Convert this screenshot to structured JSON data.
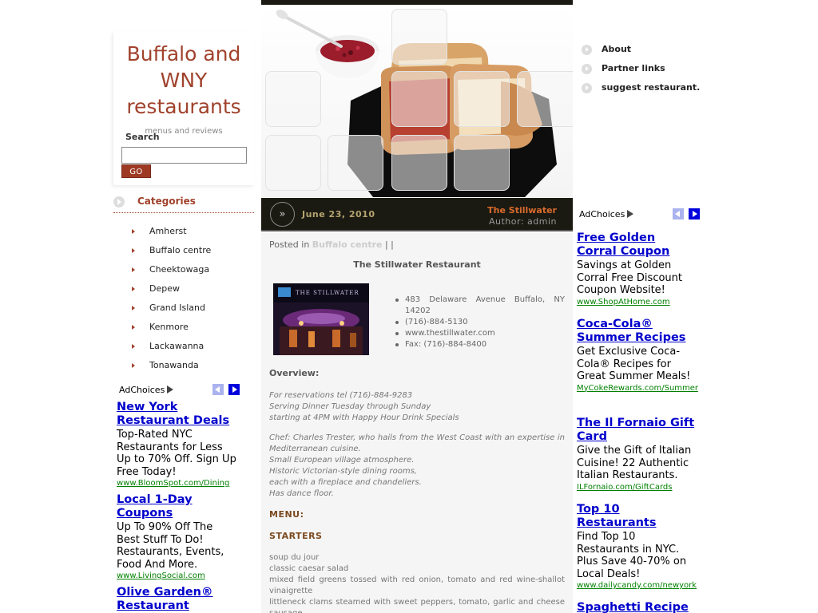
{
  "site": {
    "title": "Buffalo and WNY restaurants",
    "tagline": "menus and reviews"
  },
  "search": {
    "label": "Search",
    "placeholder": "",
    "button_label": "GO"
  },
  "categories": {
    "title": "Categories",
    "items": [
      "Amherst",
      "Buffalo centre",
      "Cheektowaga",
      "Depew",
      "Grand Island",
      "Kenmore",
      "Lackawanna",
      "Tonawanda"
    ]
  },
  "pages_nav": [
    "About",
    "Partner links",
    "suggest restaurant."
  ],
  "ads_left": {
    "adchoices": "AdChoices",
    "items": [
      {
        "title": "New York Restaurant Deals",
        "body": "Top-Rated NYC Restaurants for Less Up to 70% Off. Sign Up Free Today!",
        "url": "www.BloomSpot.com/Dining"
      },
      {
        "title": "Local 1-Day Coupons",
        "body": "Up To 90% Off The Best Stuff To Do! Restaurants, Events, Food And More.",
        "url": "www.LivingSocial.com"
      },
      {
        "title": "Olive Garden® Restaurant",
        "body": "",
        "url": ""
      }
    ]
  },
  "ads_right": {
    "adchoices": "AdChoices",
    "items": [
      {
        "title": "Free Golden Corral Coupon",
        "body": "Savings at Golden Corral Free Discount Coupon Website!",
        "url": "www.ShopAtHome.com"
      },
      {
        "title": "Coca-Cola® Summer Recipes",
        "body": "Get Exclusive Coca-Cola® Recipes for Great Summer Meals!",
        "url": "MyCokeRewards.com/Summer"
      },
      {
        "title": "The Il Fornaio Gift Card",
        "body": "Give the Gift of Italian Cuisine! 22 Authentic Italian Restaurants.",
        "url": "ILFornaio.com/GiftCards"
      },
      {
        "title": "Top 10 Restaurants",
        "body": "Find Top 10 Restaurants in NYC. Plus Save 40-70% on Local Deals!",
        "url": "www.dailycandy.com/newyork"
      },
      {
        "title": "Spaghetti Recipe",
        "body": "",
        "url": ""
      }
    ]
  },
  "post": {
    "date": "June 23, 2010",
    "title": "The Stillwater",
    "author": "Author: admin",
    "posted_in_prefix": "Posted in",
    "category": "Buffalo centre",
    "posted_in_suffix": "| |",
    "heading": "The Stillwater Restaurant",
    "photo_brand": "THE STILLWATER",
    "info": [
      "483 Delaware Avenue Buffalo, NY 14202",
      "(716)-884-5130",
      "www.thestillwater.com",
      "Fax: (716)-884-8400"
    ],
    "overview_label": "Overview:",
    "overview_lines": [
      "For reservations tel (716)-884-9283",
      "Serving Dinner Tuesday through Sunday",
      "starting at 4PM with Happy Hour Drink Specials"
    ],
    "chef_lines": [
      "Chef: Charles Trester, who hails from the West Coast with an expertise in Mediterranean cuisine.",
      "Small European village atmosphere.",
      "Historic Victorian-style dining rooms,",
      "each with a fireplace and chandeliers.",
      "Has dance floor."
    ],
    "menu_label": "MENU:",
    "starters_label": "STARTERS",
    "starters": [
      "soup du jour",
      "classic caesar salad",
      "mixed field greens tossed with red onion, tomato and red wine-shallot vinaigrette",
      "littleneck clams steamed with sweet peppers, tomato, garlic and cheese sausage"
    ]
  }
}
